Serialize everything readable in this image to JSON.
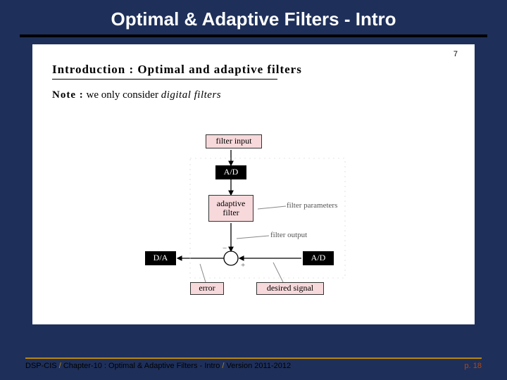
{
  "title": "Optimal & Adaptive Filters - Intro",
  "inner_page_num": "7",
  "sub_heading": "Introduction : Optimal and adaptive filters",
  "note": {
    "prefix": "Note :",
    "body": " we only consider ",
    "emph": "digital filters"
  },
  "diagram": {
    "filter_input": "filter input",
    "ad1": "A/D",
    "adaptive": "adaptive filter",
    "filter_params": "filter parameters",
    "filter_output": "filter output",
    "da": "D/A",
    "ad2": "A/D",
    "error": "error",
    "desired": "desired signal",
    "minus": "−",
    "plus": "+"
  },
  "footer": {
    "left_a": "DSP-CIS",
    "sep": "/",
    "left_b": "Chapter-10 : Optimal & Adaptive Filters - Intro",
    "left_c": "Version 2011-2012",
    "page": "p. 18"
  }
}
